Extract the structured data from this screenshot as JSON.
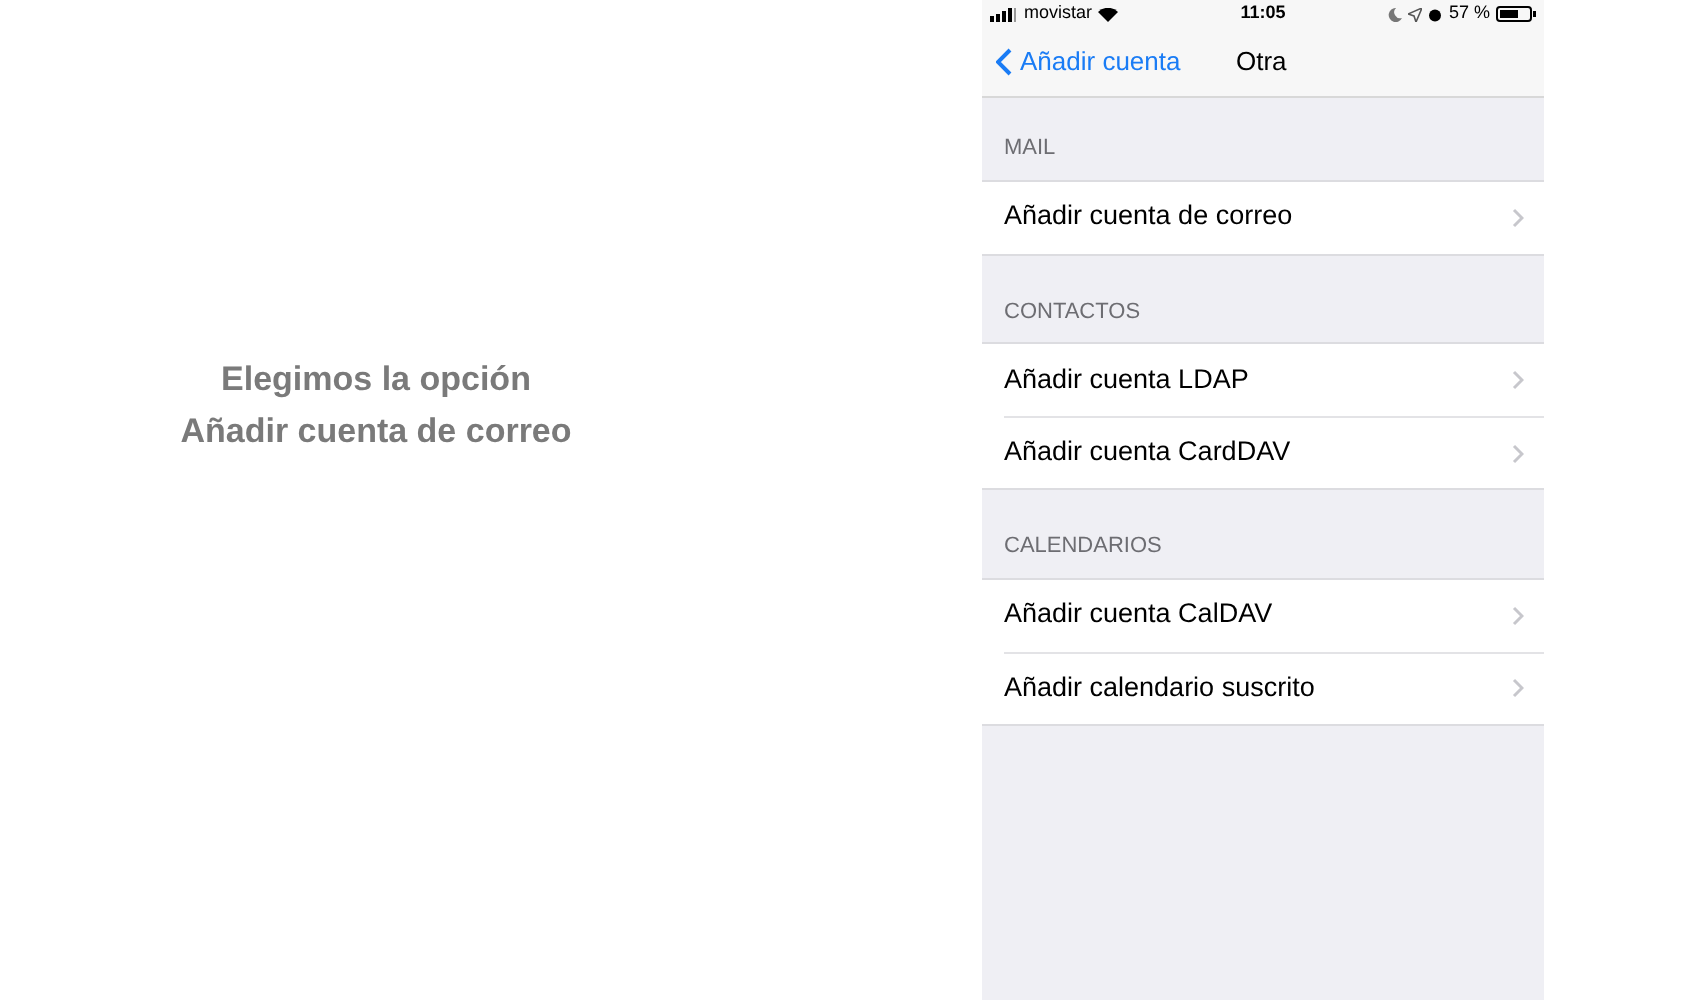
{
  "caption": [
    "Elegimos la opción",
    "Añadir cuenta de correo"
  ],
  "status_bar": {
    "carrier": "movistar",
    "time": "11:05",
    "battery": "57 %"
  },
  "nav": {
    "back": "Añadir cuenta",
    "title": "Otra"
  },
  "sections": [
    {
      "header": "MAIL",
      "rows": [
        "Añadir cuenta de correo"
      ]
    },
    {
      "header": "CONTACTOS",
      "rows": [
        "Añadir cuenta LDAP",
        "Añadir cuenta CardDAV"
      ]
    },
    {
      "header": "CALENDARIOS",
      "rows": [
        "Añadir cuenta CalDAV",
        "Añadir calendario suscrito"
      ]
    }
  ]
}
